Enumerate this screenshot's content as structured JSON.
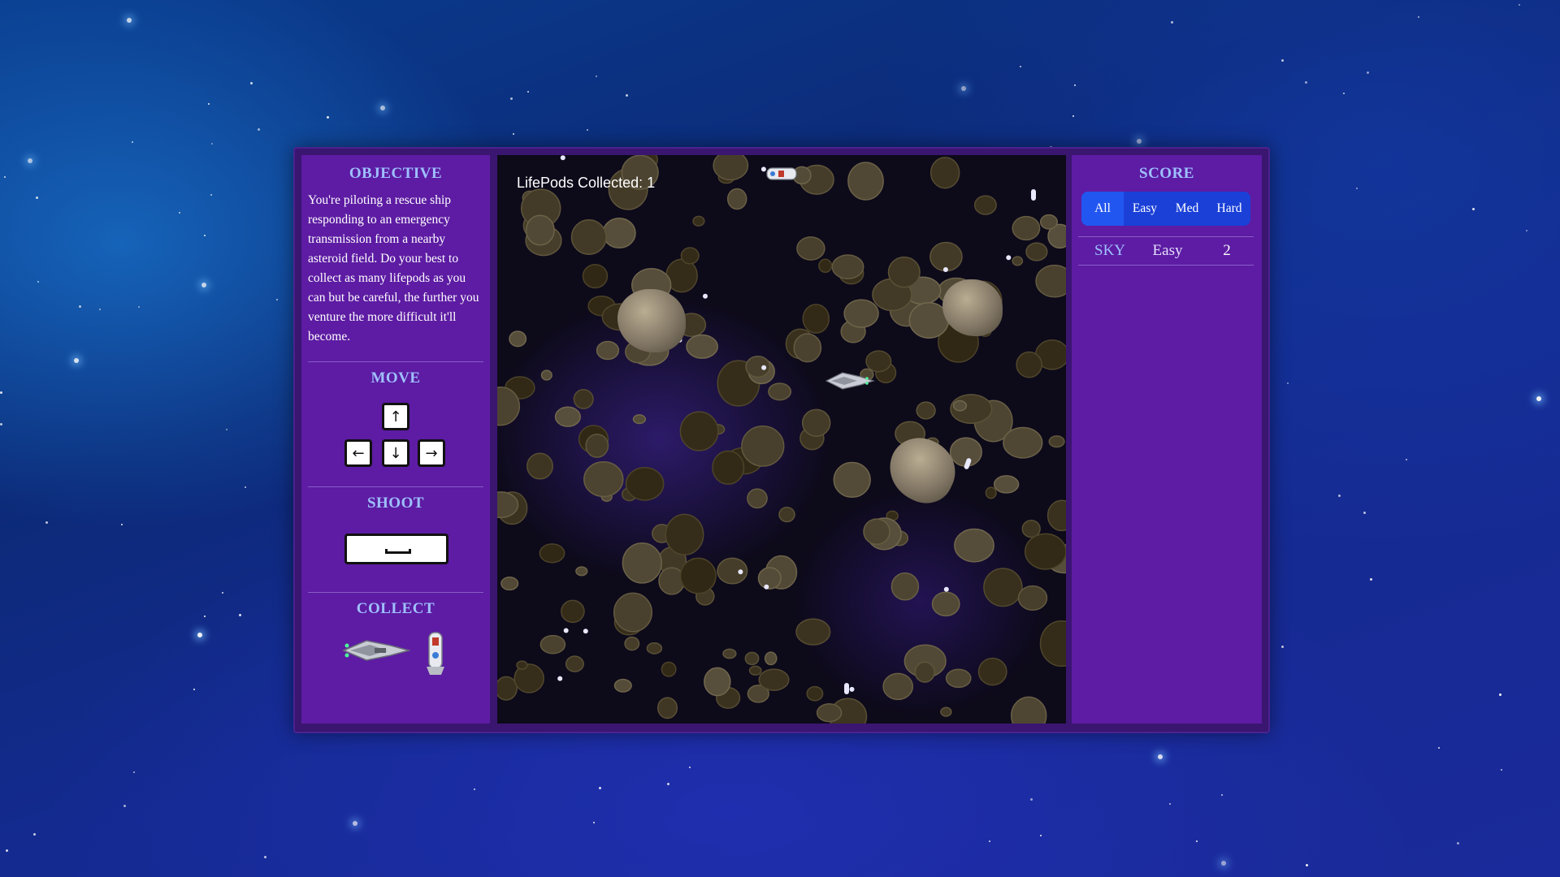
{
  "objective": {
    "title": "OBJECTIVE",
    "text": "You're piloting a rescue ship responding to an emergency transmission from a nearby asteroid field. Do your best to collect as many lifepods as you can but be careful, the further you venture the more difficult it'll become."
  },
  "controls": {
    "move_title": "MOVE",
    "keys": {
      "up": "↑",
      "left": "←",
      "down": "↓",
      "right": "→"
    },
    "shoot_title": "SHOOT",
    "space_icon": "spacebar-icon",
    "collect_title": "COLLECT"
  },
  "game": {
    "hud": "LifePods Collected: 1"
  },
  "score": {
    "title": "SCORE",
    "tabs": [
      "All",
      "Easy",
      "Med",
      "Hard"
    ],
    "active_tab": "All",
    "entries": [
      {
        "name": "SKY",
        "difficulty": "Easy",
        "points": "2"
      }
    ]
  },
  "colors": {
    "panel": "#5d1ca3",
    "frame": "#3a1670",
    "accent_title": "#9fc0ff",
    "tab_bar": "#1a40d8"
  }
}
